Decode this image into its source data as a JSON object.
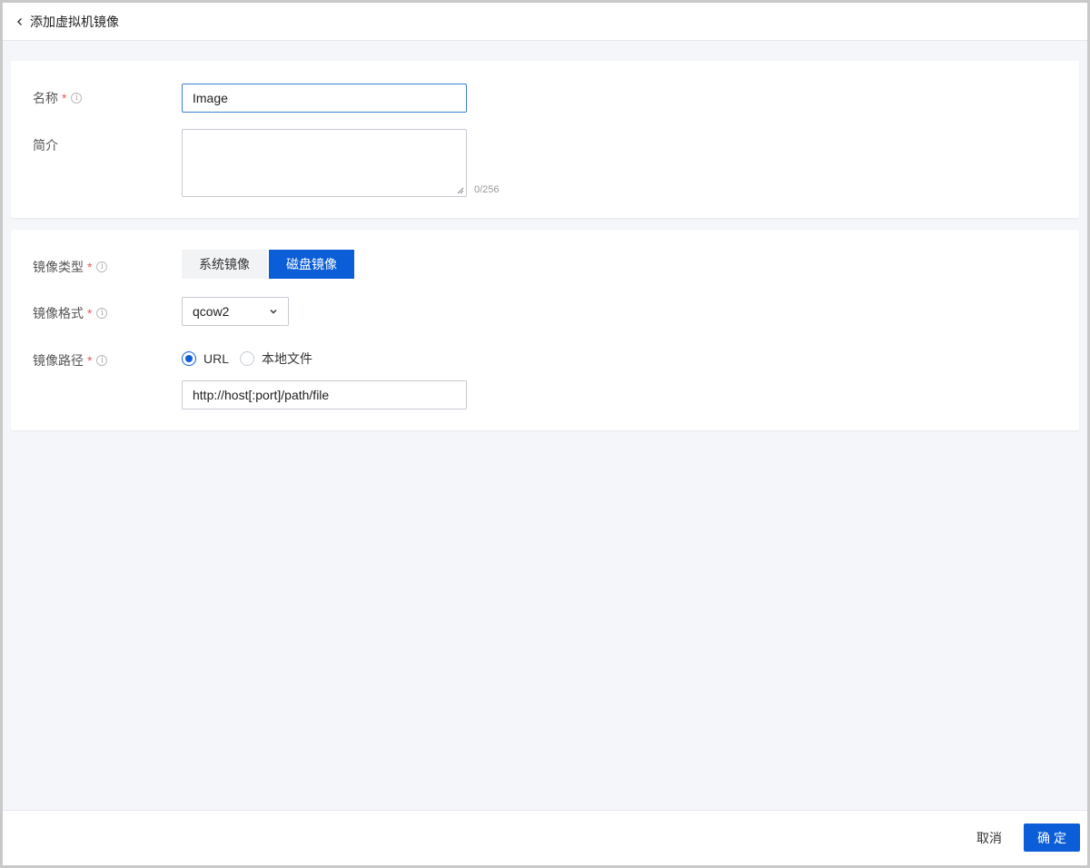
{
  "header": {
    "title": "添加虚拟机镜像",
    "back_icon": "chevron-left-icon"
  },
  "basic": {
    "name_label": "名称",
    "name_value": "Image",
    "desc_label": "简介",
    "desc_value": "",
    "desc_counter": "0/256"
  },
  "image": {
    "type_label": "镜像类型",
    "type_options": [
      "系统镜像",
      "磁盘镜像"
    ],
    "type_selected": "磁盘镜像",
    "format_label": "镜像格式",
    "format_value": "qcow2",
    "path_label": "镜像路径",
    "path_options": [
      "URL",
      "本地文件"
    ],
    "path_selected": "URL",
    "url_placeholder": "http://host[:port]/path/file"
  },
  "required_mark": "*",
  "info_icon_glyph": "i",
  "footer": {
    "cancel_label": "取消",
    "ok_label": "确定"
  },
  "colors": {
    "accent": "#0b5ed7",
    "required": "#e85a5a",
    "background": "#f5f6fa"
  }
}
